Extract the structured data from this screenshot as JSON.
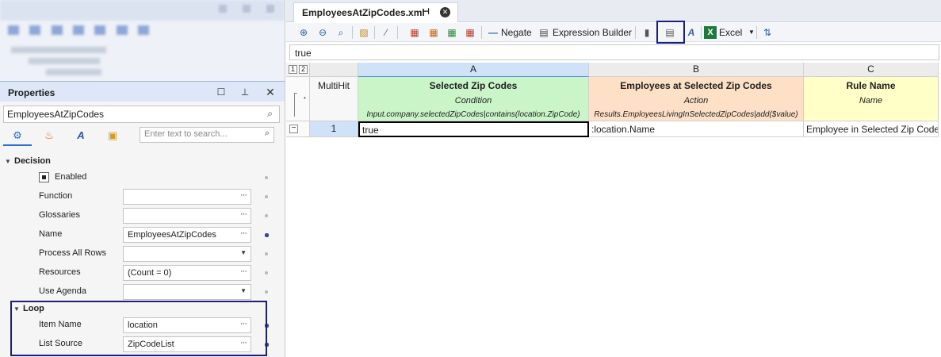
{
  "properties": {
    "title": "Properties",
    "object_name": "EmployeesAtZipCodes",
    "search_placeholder": "Enter text to search...",
    "sections": {
      "decision": "Decision",
      "loop": "Loop"
    },
    "enabled_label": "Enabled",
    "rows": {
      "function": {
        "label": "Function",
        "value": ""
      },
      "glossaries": {
        "label": "Glossaries",
        "value": ""
      },
      "name": {
        "label": "Name",
        "value": "EmployeesAtZipCodes"
      },
      "process_all_rows": {
        "label": "Process All Rows",
        "value": ""
      },
      "resources": {
        "label": "Resources",
        "value": "(Count = 0)"
      },
      "use_agenda": {
        "label": "Use Agenda",
        "value": ""
      },
      "item_name": {
        "label": "Item Name",
        "value": "location"
      },
      "list_source": {
        "label": "List Source",
        "value": "ZipCodeList"
      }
    }
  },
  "editor": {
    "tab_title": "EmployeesAtZipCodes.xml",
    "toolbar": {
      "negate": "Negate",
      "expression_builder": "Expression Builder",
      "excel": "Excel"
    },
    "formula_value": "true",
    "grid": {
      "level_buttons": [
        "1",
        "2"
      ],
      "multihit_label": "MultiHit",
      "columns": [
        {
          "letter": "A",
          "title": "Selected Zip Codes",
          "kind": "Condition",
          "expression": "Input.company.selectedZipCodes|contains(location.ZipCode)",
          "color": "#c9f5c9"
        },
        {
          "letter": "B",
          "title": "Employees at Selected Zip Codes",
          "kind": "Action",
          "expression": "Results.EmployeesLivingInSelectedZipCodes|add($value)",
          "color": "#fde0c6"
        },
        {
          "letter": "C",
          "title": "Rule Name",
          "kind": "Name",
          "expression": "",
          "color": "#ffffc8"
        }
      ],
      "rows": [
        {
          "number": "1",
          "cells": [
            "true",
            ":location.Name",
            "Employee in Selected Zip Code"
          ]
        }
      ]
    }
  }
}
